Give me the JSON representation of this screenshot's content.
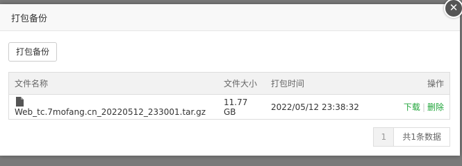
{
  "dialog": {
    "title": "打包备份",
    "close_symbol": "✕"
  },
  "toolbar": {
    "pack_label": "打包备份"
  },
  "table": {
    "headers": [
      "文件名称",
      "文件大小",
      "打包时间",
      "操作"
    ],
    "rows": [
      {
        "name": "Web_tc.7mofang.cn_20220512_233001.tar.gz",
        "size": "11.77 GB",
        "time": "2022/05/12 23:38:32",
        "download_label": "下载",
        "separator": "|",
        "delete_label": "删除",
        "icon": "file-icon"
      }
    ]
  },
  "pagination": {
    "current_page": "1",
    "total_text": "共1条数据"
  },
  "colors": {
    "link": "#20a53a",
    "header_bg": "#f2f2f2"
  }
}
